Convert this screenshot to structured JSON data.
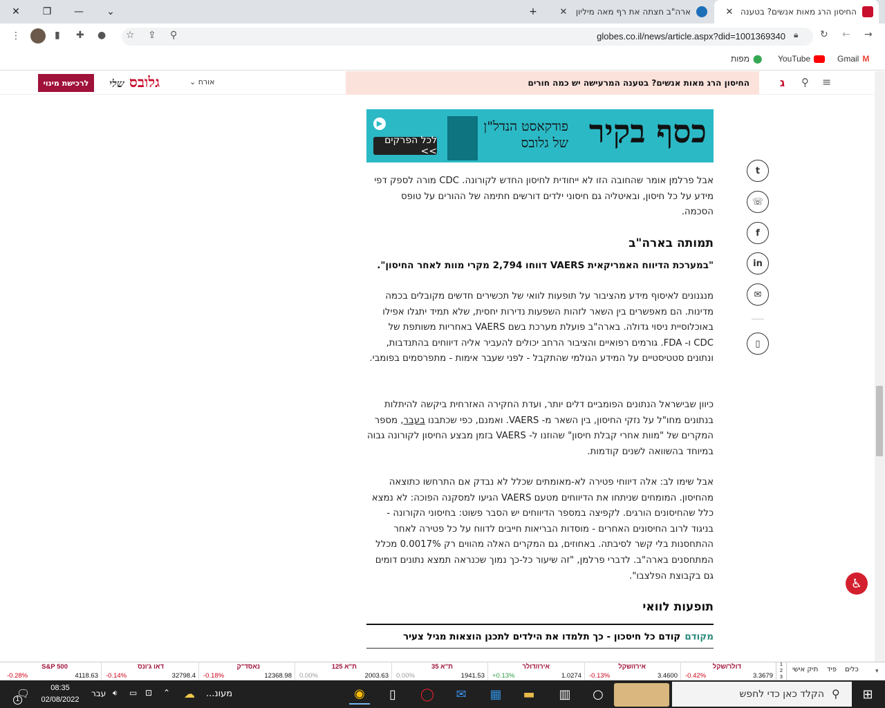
{
  "browser": {
    "tabs": [
      {
        "title": "החיסון הרג מאות אנשים? בטענה",
        "active": true
      },
      {
        "title": "ארה\"ב חצתה את רף מאה מיליון",
        "active": false
      }
    ],
    "url": "globes.co.il/news/article.aspx?did=1001369340",
    "bookmarks": [
      {
        "label": "Gmail",
        "icon": "gmail-icon"
      },
      {
        "label": "YouTube",
        "icon": "youtube-icon"
      },
      {
        "label": "מפות",
        "icon": "maps-icon"
      }
    ]
  },
  "site": {
    "headline_ticker": "החיסון הרג מאות אנשים? בטענה המרעישה יש כמה חורים",
    "guest_label": "אורח",
    "subscribe_label": "לרכישת מינוי",
    "logo_text": "גלובס",
    "logo_tag": "שלי"
  },
  "banner": {
    "title": "כסף בקיר",
    "subtitle_1": "פודקאסט הנדל\"ן",
    "subtitle_2": "של גלובס",
    "button": "לכל הפרקים >>"
  },
  "article": {
    "p1": "אבל פרלמן אומר שהחובה הזו לא ייחודית לחיסון החדש לקורונה. CDC מורה לספק דפי מידע על כל חיסון, ובאיטליה גם חיסוני ילדים דורשים חתימה של ההורים על טופס הסכמה.",
    "h_usa": "תמותה בארה\"ב",
    "quote": "\"במערכת הדיווח האמריקאית VAERS דווחו 2,794 מקרי מוות לאחר החיסון\".",
    "p2": "מנגנונים לאיסוף מידע מהציבור על תופעות לוואי של תכשירים חדשים מקובלים בכמה מדינות. הם מאפשרים בין השאר לזהות השפעות נדירות יחסית, שלא תמיד יתגלו אפילו באוכלוסיית ניסוי גדולה. בארה\"ב פועלת מערכת בשם VAERS באחריות משותפת של CDC ו- FDA. גורמים רפואיים והציבור הרחב יכולים להעביר אליה דיווחים בהתנדבות, ונתונים סטטיסטיים על המידע הגולמי שהתקבל - לפני שעבר אימות - מתפרסמים בפומבי.",
    "p3_before": "כיוון שבישראל הנתונים הפומביים דלים יותר, ועדת החקירה האזרחית ביקשה להיתלות בנתונים מחו\"ל על נזקי החיסון, בין השאר מ- VAERS. ואמנם, כפי שכתבנו ",
    "p3_link": "בעבר",
    "p3_after": ", מספר המקרים של \"מוות אחרי קבלת חיסון\" שהוזנו ל- VAERS בזמן מבצע החיסון לקורונה גבוה במיוחד בהשוואה לשנים קודמות.",
    "p4": "אבל שימו לב: אלה דיווחי פטירה לא-מאומתים שכלל לא נבדק אם התרחשו כתוצאה מהחיסון. המומחים שניתחו את הדיווחים מטעם VAERS הגיעו למסקנה הפוכה: לא נמצא כלל שהחיסונים הורגים. לקפיצה במספר הדיווחים יש הסבר פשוט: בחיסוני הקורונה - בניגוד לרוב החיסונים האחרים - מוסדות הבריאות חייבים לדווח על כל פטירה לאחר ההתחסנות בלי קשר לסיבתה. באחוזים, גם המקרים האלה מהווים רק 0.0017% מכלל המתחסנים בארה\"ב. לדברי פרלמן, \"זה שיעור כל-כך נמוך שכנראה תמצא נתונים דומים גם בקבוצת הפלצבו\".",
    "h_side": "תופעות לוואי",
    "related_label": "מקודם",
    "related_text": "קודם כל חיסכון - כך תלמדו את הילדים לתכנן הוצאות מגיל צעיר"
  },
  "market": {
    "tabs": [
      "כלים",
      "פיד",
      "תיק אישי"
    ],
    "pager": [
      "1",
      "2",
      "3"
    ],
    "items": [
      {
        "name": "דולר/שקל",
        "value": "3.3679",
        "change": "-0.42%",
        "dir": "neg"
      },
      {
        "name": "אירו/שקל",
        "value": "3.4600",
        "change": "-0.13%",
        "dir": "neg"
      },
      {
        "name": "אירו/דולר",
        "value": "1.0274",
        "change": "+0.13%",
        "dir": "pos"
      },
      {
        "name": "ת\"א 35",
        "value": "1941.53",
        "change": "0.00%",
        "dir": "zero"
      },
      {
        "name": "ת\"א 125",
        "value": "2003.63",
        "change": "0.00%",
        "dir": "zero"
      },
      {
        "name": "נאסד\"ק",
        "value": "12368.98",
        "change": "-0.18%",
        "dir": "neg"
      },
      {
        "name": "דאו ג'ונס",
        "value": "32798.4",
        "change": "-0.14%",
        "dir": "neg"
      },
      {
        "name": "S&P 500",
        "value": "4118.63",
        "change": "-0.28%",
        "dir": "neg"
      }
    ]
  },
  "taskbar": {
    "search_placeholder": "הקלד כאן כדי לחפש",
    "weather": "מעונ...",
    "lang": "עבר",
    "time": "08:35",
    "date": "02/08/2022",
    "notifications": "1"
  }
}
